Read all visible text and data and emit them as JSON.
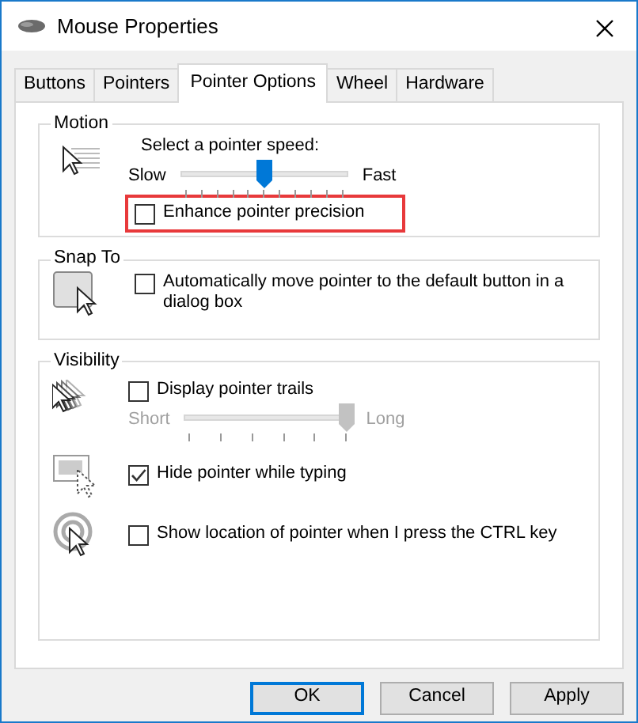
{
  "window": {
    "title": "Mouse Properties"
  },
  "tabs": [
    {
      "label": "Buttons",
      "selected": false
    },
    {
      "label": "Pointers",
      "selected": false
    },
    {
      "label": "Pointer Options",
      "selected": true
    },
    {
      "label": "Wheel",
      "selected": false
    },
    {
      "label": "Hardware",
      "selected": false
    }
  ],
  "motion": {
    "title": "Motion",
    "speed_label": "Select a pointer speed:",
    "slow_label": "Slow",
    "fast_label": "Fast",
    "speed": {
      "level": 0.5
    },
    "enhance_precision": {
      "label": "Enhance pointer precision",
      "checked": false,
      "highlighted": true
    }
  },
  "snap_to": {
    "title": "Snap To",
    "option": {
      "label": "Automatically move pointer to the default button in a dialog box",
      "checked": false
    }
  },
  "visibility": {
    "title": "Visibility",
    "trails": {
      "label": "Display pointer trails",
      "checked": false
    },
    "trail_length": {
      "short_label": "Short",
      "long_label": "Long",
      "level": 1,
      "disabled": true
    },
    "hide_while_typing": {
      "label": "Hide pointer while typing",
      "checked": true
    },
    "show_location": {
      "label": "Show location of pointer when I press the CTRL key",
      "checked": false
    }
  },
  "buttons": [
    {
      "label": "OK",
      "default": true
    },
    {
      "label": "Cancel",
      "default": false
    },
    {
      "label": "Apply",
      "default": false
    }
  ]
}
